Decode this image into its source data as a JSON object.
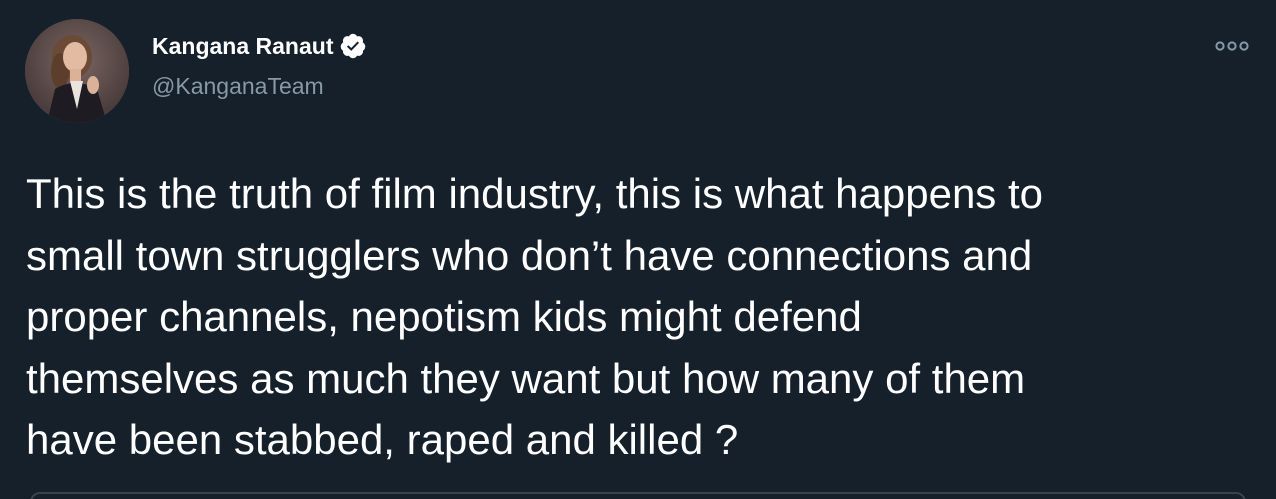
{
  "tweet": {
    "author": {
      "display_name": "Kangana Ranaut",
      "handle": "@KanganaTeam",
      "verified": true,
      "verified_icon": "verified-badge-icon"
    },
    "more_icon": "more-options-icon",
    "text": "This is the truth of film industry, this is what happens to\nsmall town strugglers who don’t have connections and\nproper channels, nepotism kids might defend\nthemselves as much they want but how many of them\nhave been stabbed, raped and killed ?"
  },
  "colors": {
    "background": "#15202b",
    "primary_text": "#ffffff",
    "secondary_text": "#8899a6",
    "border": "#38444d"
  }
}
